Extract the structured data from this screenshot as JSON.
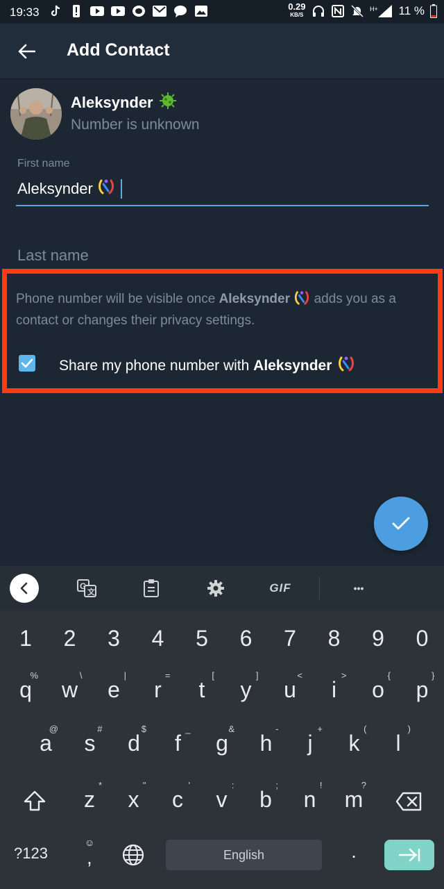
{
  "status_bar": {
    "time": "19:33",
    "net_speed": "0.29",
    "net_unit": "KB/S",
    "signal": "H+",
    "battery": "11 %"
  },
  "app_bar": {
    "back_icon": "arrow-left-icon",
    "title": "Add Contact"
  },
  "contact": {
    "name": "Aleksynder",
    "name_emoji": "🦠",
    "status": "Number is unknown"
  },
  "form": {
    "first_name_label": "First name",
    "first_name_value": "Aleksynder",
    "last_name_placeholder": "Last name"
  },
  "privacy": {
    "info_before": "Phone number will be visible once ",
    "info_name": "Aleksynder",
    "info_after": " adds you as a contact or changes their privacy settings.",
    "share_label": "Share my phone number with ",
    "share_name": "Aleksynder",
    "share_checked": true
  },
  "keyboard": {
    "toolbar": {
      "gif_label": "GIF",
      "more_label": "•••"
    },
    "numbers": [
      "1",
      "2",
      "3",
      "4",
      "5",
      "6",
      "7",
      "8",
      "9",
      "0"
    ],
    "row1": [
      {
        "k": "q",
        "h": "%"
      },
      {
        "k": "w",
        "h": "\\"
      },
      {
        "k": "e",
        "h": "|"
      },
      {
        "k": "r",
        "h": "="
      },
      {
        "k": "t",
        "h": "["
      },
      {
        "k": "y",
        "h": "]"
      },
      {
        "k": "u",
        "h": "<"
      },
      {
        "k": "i",
        "h": ">"
      },
      {
        "k": "o",
        "h": "{"
      },
      {
        "k": "p",
        "h": "}"
      }
    ],
    "row2": [
      {
        "k": "a",
        "h": "@"
      },
      {
        "k": "s",
        "h": "#"
      },
      {
        "k": "d",
        "h": "$"
      },
      {
        "k": "f",
        "h": "_"
      },
      {
        "k": "g",
        "h": "&"
      },
      {
        "k": "h",
        "h": "-"
      },
      {
        "k": "j",
        "h": "+"
      },
      {
        "k": "k",
        "h": "("
      },
      {
        "k": "l",
        "h": ")"
      }
    ],
    "row3": [
      {
        "k": "z",
        "h": "*"
      },
      {
        "k": "x",
        "h": "\""
      },
      {
        "k": "c",
        "h": "'"
      },
      {
        "k": "v",
        "h": ":"
      },
      {
        "k": "b",
        "h": ";"
      },
      {
        "k": "n",
        "h": "!"
      },
      {
        "k": "m",
        "h": "?"
      }
    ],
    "symbols_label": "?123",
    "comma": ",",
    "space_label": "English",
    "period": "."
  },
  "colors": {
    "accent": "#5fa8e1",
    "highlight_border": "#ff3b12",
    "background": "#1d2733"
  }
}
